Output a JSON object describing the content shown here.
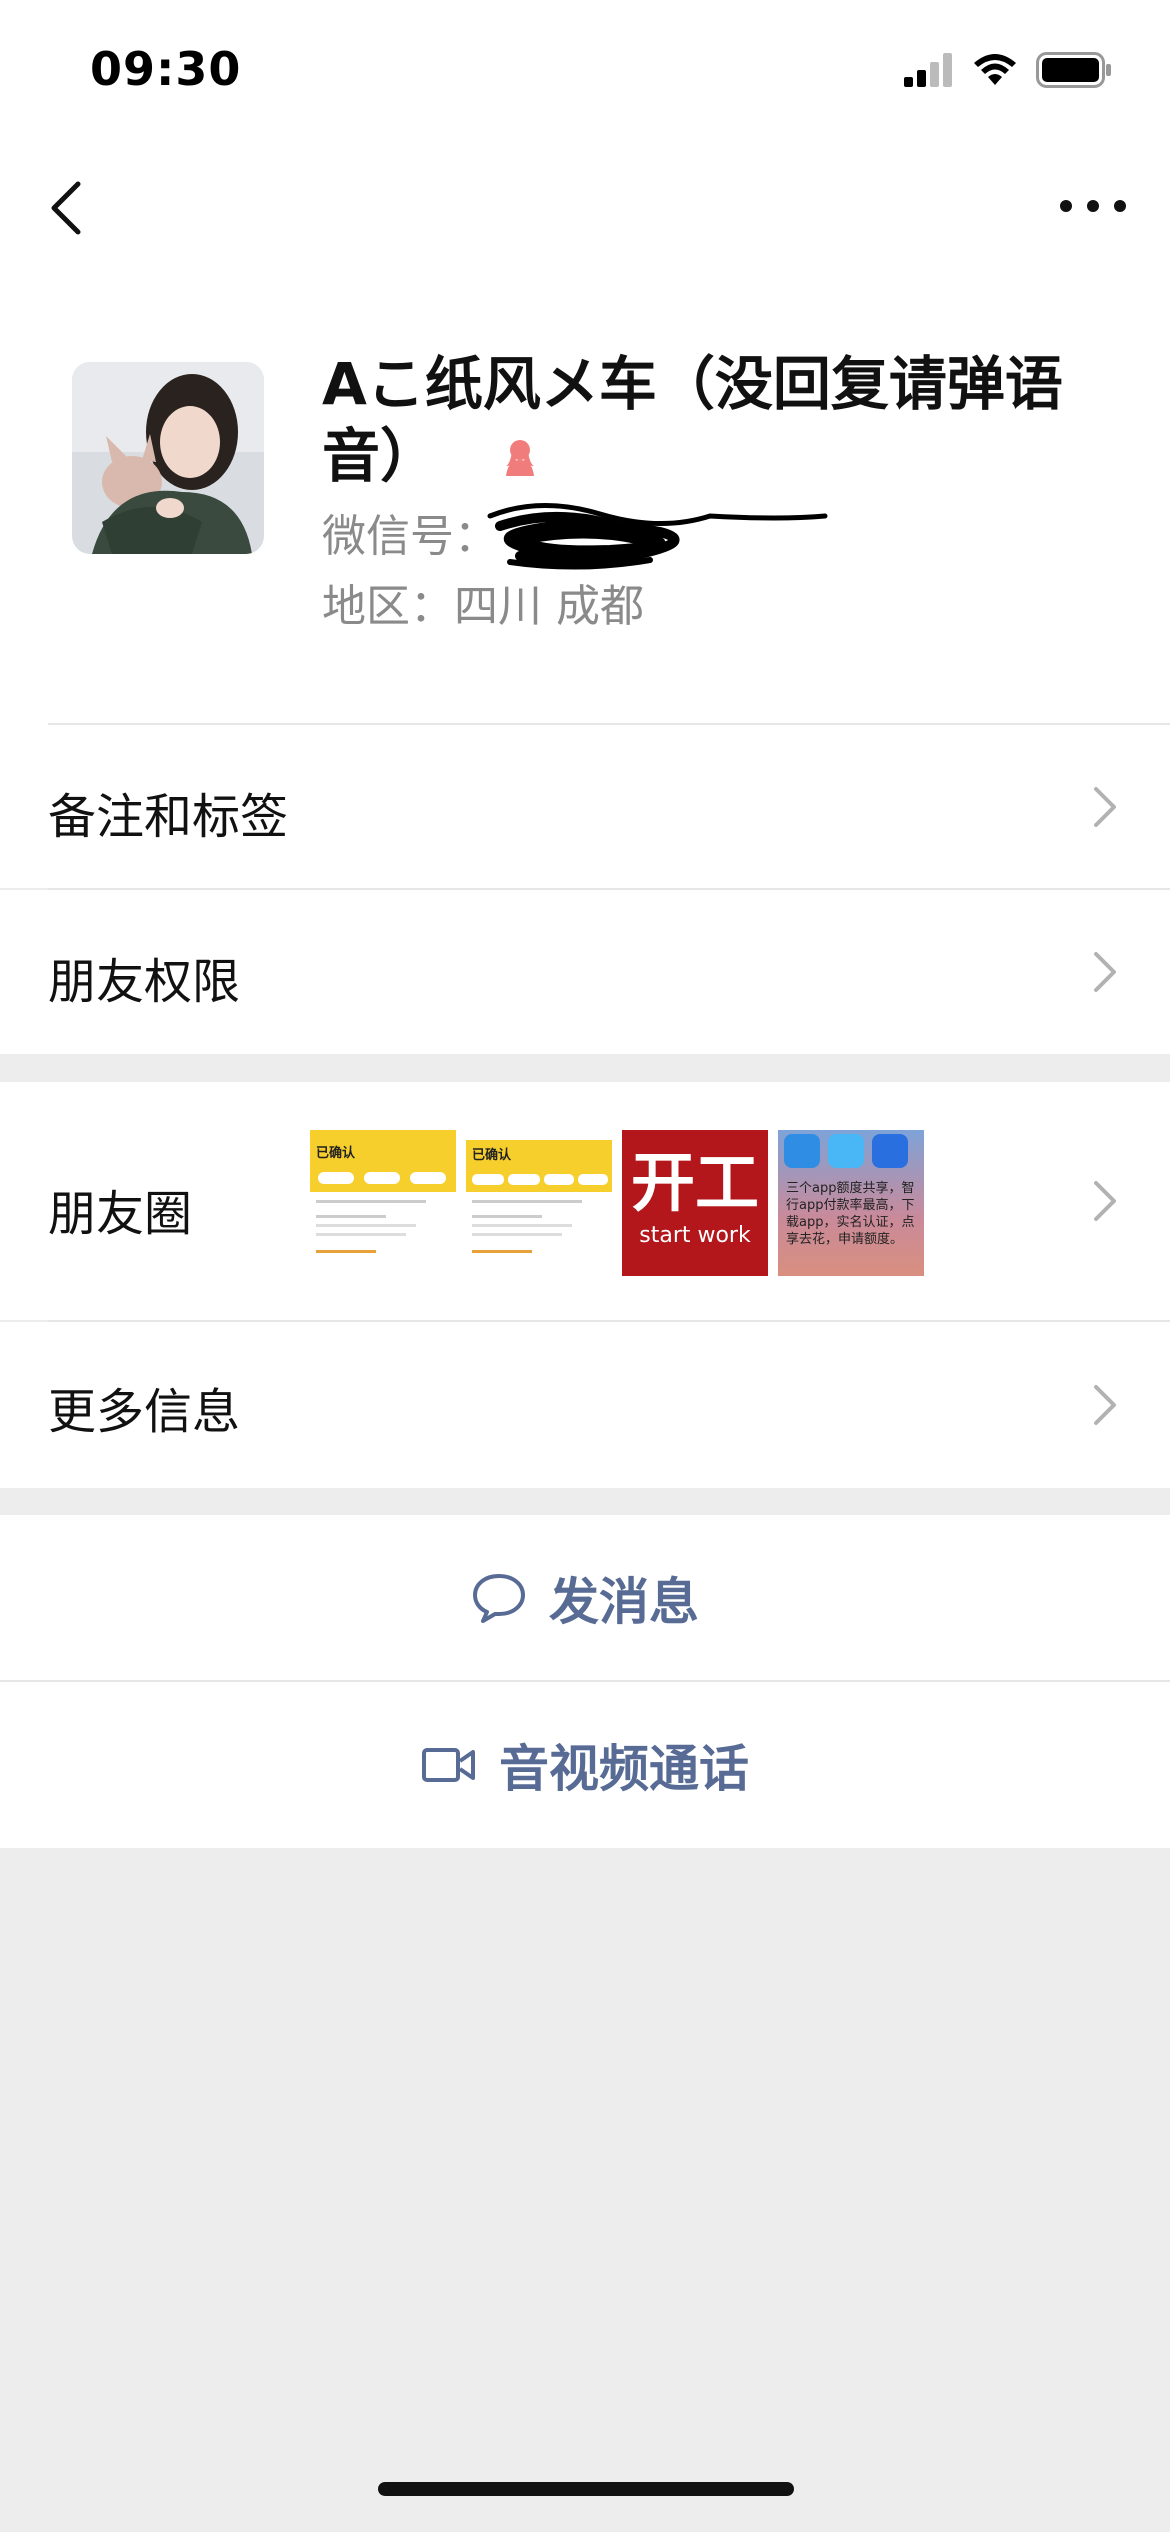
{
  "status": {
    "time": "09:30"
  },
  "profile": {
    "name": "Aこ纸风メ车（没回复请弹语音）",
    "wechat_label": "微信号：",
    "region_label": "地区：",
    "region_value": "四川 成都"
  },
  "menu": {
    "remarks": "备注和标签",
    "permissions": "朋友权限",
    "moments": "朋友圈",
    "more_info": "更多信息"
  },
  "moments_thumbs": [
    {
      "title": "已确认"
    },
    {
      "title": "已确认"
    },
    {
      "big": "开工",
      "small": "start work",
      "color": "#b3161b"
    },
    {
      "text": "三个app额度共享，智行app付款率最高，下载app，实名认证，点享去花，申请额度。"
    }
  ],
  "actions": {
    "message": "发消息",
    "call": "音视频通话"
  },
  "colors": {
    "link": "#576b95",
    "gender_female": "#f07c7c",
    "background": "#ededed"
  }
}
